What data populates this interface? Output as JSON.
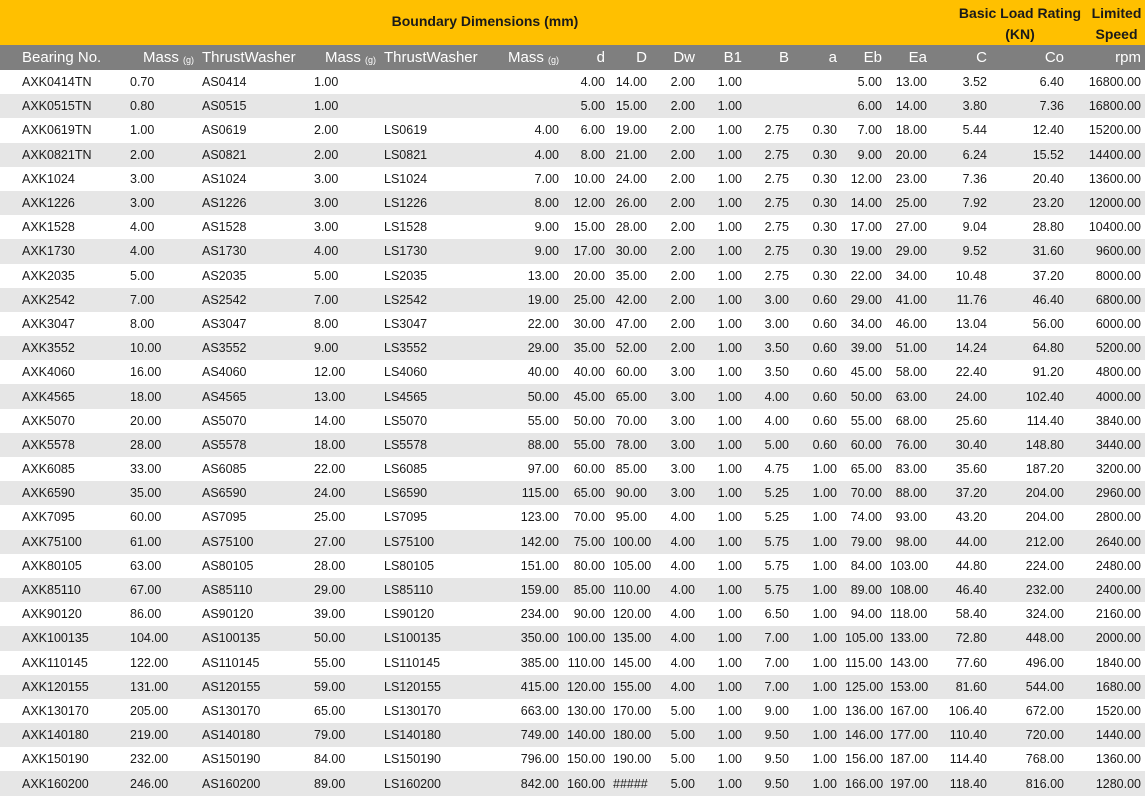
{
  "banner": {
    "title": "Boundary Dimensions (mm)",
    "load_rating_line1": "Basic Load Rating",
    "load_rating_line2": "(KN)",
    "speed_line1": "Limited",
    "speed_line2": "Speed"
  },
  "headers": {
    "bearing": "Bearing No.",
    "mass1": "Mass",
    "mass1_unit": "(g)",
    "washer1": "ThrustWasher",
    "mass2": "Mass",
    "mass2_unit": "(g)",
    "washer2": "ThrustWasher",
    "mass3": "Mass",
    "mass3_unit": "(g)",
    "d": "d",
    "D": "D",
    "Dw": "Dw",
    "B1": "B1",
    "B": "B",
    "a": "a",
    "Eb": "Eb",
    "Ea": "Ea",
    "C": "C",
    "Co": "Co",
    "rpm": "rpm"
  },
  "rows": [
    [
      "AXK0414TN",
      "0.70",
      "AS0414",
      "1.00",
      "",
      "",
      "4.00",
      "14.00",
      "2.00",
      "1.00",
      "",
      "",
      "5.00",
      "13.00",
      "3.52",
      "6.40",
      "16800.00"
    ],
    [
      "AXK0515TN",
      "0.80",
      "AS0515",
      "1.00",
      "",
      "",
      "5.00",
      "15.00",
      "2.00",
      "1.00",
      "",
      "",
      "6.00",
      "14.00",
      "3.80",
      "7.36",
      "16800.00"
    ],
    [
      "AXK0619TN",
      "1.00",
      "AS0619",
      "2.00",
      "LS0619",
      "4.00",
      "6.00",
      "19.00",
      "2.00",
      "1.00",
      "2.75",
      "0.30",
      "7.00",
      "18.00",
      "5.44",
      "12.40",
      "15200.00"
    ],
    [
      "AXK0821TN",
      "2.00",
      "AS0821",
      "2.00",
      "LS0821",
      "4.00",
      "8.00",
      "21.00",
      "2.00",
      "1.00",
      "2.75",
      "0.30",
      "9.00",
      "20.00",
      "6.24",
      "15.52",
      "14400.00"
    ],
    [
      "AXK1024",
      "3.00",
      "AS1024",
      "3.00",
      "LS1024",
      "7.00",
      "10.00",
      "24.00",
      "2.00",
      "1.00",
      "2.75",
      "0.30",
      "12.00",
      "23.00",
      "7.36",
      "20.40",
      "13600.00"
    ],
    [
      "AXK1226",
      "3.00",
      "AS1226",
      "3.00",
      "LS1226",
      "8.00",
      "12.00",
      "26.00",
      "2.00",
      "1.00",
      "2.75",
      "0.30",
      "14.00",
      "25.00",
      "7.92",
      "23.20",
      "12000.00"
    ],
    [
      "AXK1528",
      "4.00",
      "AS1528",
      "3.00",
      "LS1528",
      "9.00",
      "15.00",
      "28.00",
      "2.00",
      "1.00",
      "2.75",
      "0.30",
      "17.00",
      "27.00",
      "9.04",
      "28.80",
      "10400.00"
    ],
    [
      "AXK1730",
      "4.00",
      "AS1730",
      "4.00",
      "LS1730",
      "9.00",
      "17.00",
      "30.00",
      "2.00",
      "1.00",
      "2.75",
      "0.30",
      "19.00",
      "29.00",
      "9.52",
      "31.60",
      "9600.00"
    ],
    [
      "AXK2035",
      "5.00",
      "AS2035",
      "5.00",
      "LS2035",
      "13.00",
      "20.00",
      "35.00",
      "2.00",
      "1.00",
      "2.75",
      "0.30",
      "22.00",
      "34.00",
      "10.48",
      "37.20",
      "8000.00"
    ],
    [
      "AXK2542",
      "7.00",
      "AS2542",
      "7.00",
      "LS2542",
      "19.00",
      "25.00",
      "42.00",
      "2.00",
      "1.00",
      "3.00",
      "0.60",
      "29.00",
      "41.00",
      "11.76",
      "46.40",
      "6800.00"
    ],
    [
      "AXK3047",
      "8.00",
      "AS3047",
      "8.00",
      "LS3047",
      "22.00",
      "30.00",
      "47.00",
      "2.00",
      "1.00",
      "3.00",
      "0.60",
      "34.00",
      "46.00",
      "13.04",
      "56.00",
      "6000.00"
    ],
    [
      "AXK3552",
      "10.00",
      "AS3552",
      "9.00",
      "LS3552",
      "29.00",
      "35.00",
      "52.00",
      "2.00",
      "1.00",
      "3.50",
      "0.60",
      "39.00",
      "51.00",
      "14.24",
      "64.80",
      "5200.00"
    ],
    [
      "AXK4060",
      "16.00",
      "AS4060",
      "12.00",
      "LS4060",
      "40.00",
      "40.00",
      "60.00",
      "3.00",
      "1.00",
      "3.50",
      "0.60",
      "45.00",
      "58.00",
      "22.40",
      "91.20",
      "4800.00"
    ],
    [
      "AXK4565",
      "18.00",
      "AS4565",
      "13.00",
      "LS4565",
      "50.00",
      "45.00",
      "65.00",
      "3.00",
      "1.00",
      "4.00",
      "0.60",
      "50.00",
      "63.00",
      "24.00",
      "102.40",
      "4000.00"
    ],
    [
      "AXK5070",
      "20.00",
      "AS5070",
      "14.00",
      "LS5070",
      "55.00",
      "50.00",
      "70.00",
      "3.00",
      "1.00",
      "4.00",
      "0.60",
      "55.00",
      "68.00",
      "25.60",
      "114.40",
      "3840.00"
    ],
    [
      "AXK5578",
      "28.00",
      "AS5578",
      "18.00",
      "LS5578",
      "88.00",
      "55.00",
      "78.00",
      "3.00",
      "1.00",
      "5.00",
      "0.60",
      "60.00",
      "76.00",
      "30.40",
      "148.80",
      "3440.00"
    ],
    [
      "AXK6085",
      "33.00",
      "AS6085",
      "22.00",
      "LS6085",
      "97.00",
      "60.00",
      "85.00",
      "3.00",
      "1.00",
      "4.75",
      "1.00",
      "65.00",
      "83.00",
      "35.60",
      "187.20",
      "3200.00"
    ],
    [
      "AXK6590",
      "35.00",
      "AS6590",
      "24.00",
      "LS6590",
      "115.00",
      "65.00",
      "90.00",
      "3.00",
      "1.00",
      "5.25",
      "1.00",
      "70.00",
      "88.00",
      "37.20",
      "204.00",
      "2960.00"
    ],
    [
      "AXK7095",
      "60.00",
      "AS7095",
      "25.00",
      "LS7095",
      "123.00",
      "70.00",
      "95.00",
      "4.00",
      "1.00",
      "5.25",
      "1.00",
      "74.00",
      "93.00",
      "43.20",
      "204.00",
      "2800.00"
    ],
    [
      "AXK75100",
      "61.00",
      "AS75100",
      "27.00",
      "LS75100",
      "142.00",
      "75.00",
      "100.00",
      "4.00",
      "1.00",
      "5.75",
      "1.00",
      "79.00",
      "98.00",
      "44.00",
      "212.00",
      "2640.00"
    ],
    [
      "AXK80105",
      "63.00",
      "AS80105",
      "28.00",
      "LS80105",
      "151.00",
      "80.00",
      "105.00",
      "4.00",
      "1.00",
      "5.75",
      "1.00",
      "84.00",
      "103.00",
      "44.80",
      "224.00",
      "2480.00"
    ],
    [
      "AXK85110",
      "67.00",
      "AS85110",
      "29.00",
      "LS85110",
      "159.00",
      "85.00",
      "110.00",
      "4.00",
      "1.00",
      "5.75",
      "1.00",
      "89.00",
      "108.00",
      "46.40",
      "232.00",
      "2400.00"
    ],
    [
      "AXK90120",
      "86.00",
      "AS90120",
      "39.00",
      "LS90120",
      "234.00",
      "90.00",
      "120.00",
      "4.00",
      "1.00",
      "6.50",
      "1.00",
      "94.00",
      "118.00",
      "58.40",
      "324.00",
      "2160.00"
    ],
    [
      "AXK100135",
      "104.00",
      "AS100135",
      "50.00",
      "LS100135",
      "350.00",
      "100.00",
      "135.00",
      "4.00",
      "1.00",
      "7.00",
      "1.00",
      "105.00",
      "133.00",
      "72.80",
      "448.00",
      "2000.00"
    ],
    [
      "AXK110145",
      "122.00",
      "AS110145",
      "55.00",
      "LS110145",
      "385.00",
      "110.00",
      "145.00",
      "4.00",
      "1.00",
      "7.00",
      "1.00",
      "115.00",
      "143.00",
      "77.60",
      "496.00",
      "1840.00"
    ],
    [
      "AXK120155",
      "131.00",
      "AS120155",
      "59.00",
      "LS120155",
      "415.00",
      "120.00",
      "155.00",
      "4.00",
      "1.00",
      "7.00",
      "1.00",
      "125.00",
      "153.00",
      "81.60",
      "544.00",
      "1680.00"
    ],
    [
      "AXK130170",
      "205.00",
      "AS130170",
      "65.00",
      "LS130170",
      "663.00",
      "130.00",
      "170.00",
      "5.00",
      "1.00",
      "9.00",
      "1.00",
      "136.00",
      "167.00",
      "106.40",
      "672.00",
      "1520.00"
    ],
    [
      "AXK140180",
      "219.00",
      "AS140180",
      "79.00",
      "LS140180",
      "749.00",
      "140.00",
      "180.00",
      "5.00",
      "1.00",
      "9.50",
      "1.00",
      "146.00",
      "177.00",
      "110.40",
      "720.00",
      "1440.00"
    ],
    [
      "AXK150190",
      "232.00",
      "AS150190",
      "84.00",
      "LS150190",
      "796.00",
      "150.00",
      "190.00",
      "5.00",
      "1.00",
      "9.50",
      "1.00",
      "156.00",
      "187.00",
      "114.40",
      "768.00",
      "1360.00"
    ],
    [
      "AXK160200",
      "246.00",
      "AS160200",
      "89.00",
      "LS160200",
      "842.00",
      "160.00",
      "#####",
      "5.00",
      "1.00",
      "9.50",
      "1.00",
      "166.00",
      "197.00",
      "118.40",
      "816.00",
      "1280.00"
    ]
  ]
}
